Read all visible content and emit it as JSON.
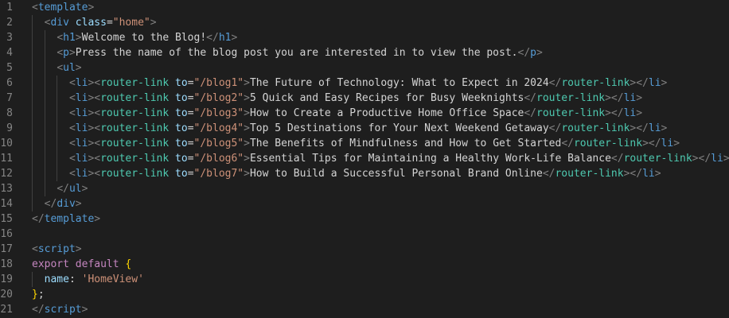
{
  "editor": {
    "language": "vue",
    "colors": {
      "background": "#1e1e1e",
      "tag": "#569cd6",
      "bracket": "#808080",
      "component": "#4ec9b0",
      "attribute": "#9cdcfe",
      "string": "#ce9178",
      "text": "#d4d4d4",
      "keyword": "#c586c0",
      "brace": "#ffd700",
      "line_number": "#858585"
    },
    "lines": [
      {
        "n": "1",
        "indent": 0,
        "tokens": [
          [
            "bracket",
            "<"
          ],
          [
            "tag",
            "template"
          ],
          [
            "bracket",
            ">"
          ]
        ]
      },
      {
        "n": "2",
        "indent": 1,
        "tokens": [
          [
            "bracket",
            "<"
          ],
          [
            "tag",
            "div"
          ],
          [
            "text",
            " "
          ],
          [
            "attr",
            "class"
          ],
          [
            "text",
            "="
          ],
          [
            "str",
            "\"home\""
          ],
          [
            "bracket",
            ">"
          ]
        ]
      },
      {
        "n": "3",
        "indent": 2,
        "tokens": [
          [
            "bracket",
            "<"
          ],
          [
            "tag",
            "h1"
          ],
          [
            "bracket",
            ">"
          ],
          [
            "text",
            "Welcome to the Blog!"
          ],
          [
            "bracket",
            "</"
          ],
          [
            "tag",
            "h1"
          ],
          [
            "bracket",
            ">"
          ]
        ]
      },
      {
        "n": "4",
        "indent": 2,
        "tokens": [
          [
            "bracket",
            "<"
          ],
          [
            "tag",
            "p"
          ],
          [
            "bracket",
            ">"
          ],
          [
            "text",
            "Press the name of the blog post you are interested in to view the post."
          ],
          [
            "bracket",
            "</"
          ],
          [
            "tag",
            "p"
          ],
          [
            "bracket",
            ">"
          ]
        ]
      },
      {
        "n": "5",
        "indent": 2,
        "tokens": [
          [
            "bracket",
            "<"
          ],
          [
            "tag",
            "ul"
          ],
          [
            "bracket",
            ">"
          ]
        ]
      },
      {
        "n": "6",
        "indent": 3,
        "tokens": [
          [
            "bracket",
            "<"
          ],
          [
            "tag",
            "li"
          ],
          [
            "bracket",
            ">"
          ],
          [
            "bracket",
            "<"
          ],
          [
            "comp",
            "router-link"
          ],
          [
            "text",
            " "
          ],
          [
            "attr",
            "to"
          ],
          [
            "text",
            "="
          ],
          [
            "str",
            "\"/blog1\""
          ],
          [
            "bracket",
            ">"
          ],
          [
            "text",
            "The Future of Technology: What to Expect in 2024"
          ],
          [
            "bracket",
            "</"
          ],
          [
            "comp",
            "router-link"
          ],
          [
            "bracket",
            ">"
          ],
          [
            "bracket",
            "</"
          ],
          [
            "tag",
            "li"
          ],
          [
            "bracket",
            ">"
          ]
        ]
      },
      {
        "n": "7",
        "indent": 3,
        "tokens": [
          [
            "bracket",
            "<"
          ],
          [
            "tag",
            "li"
          ],
          [
            "bracket",
            ">"
          ],
          [
            "bracket",
            "<"
          ],
          [
            "comp",
            "router-link"
          ],
          [
            "text",
            " "
          ],
          [
            "attr",
            "to"
          ],
          [
            "text",
            "="
          ],
          [
            "str",
            "\"/blog2\""
          ],
          [
            "bracket",
            ">"
          ],
          [
            "text",
            "5 Quick and Easy Recipes for Busy Weeknights"
          ],
          [
            "bracket",
            "</"
          ],
          [
            "comp",
            "router-link"
          ],
          [
            "bracket",
            ">"
          ],
          [
            "bracket",
            "</"
          ],
          [
            "tag",
            "li"
          ],
          [
            "bracket",
            ">"
          ]
        ]
      },
      {
        "n": "8",
        "indent": 3,
        "tokens": [
          [
            "bracket",
            "<"
          ],
          [
            "tag",
            "li"
          ],
          [
            "bracket",
            ">"
          ],
          [
            "bracket",
            "<"
          ],
          [
            "comp",
            "router-link"
          ],
          [
            "text",
            " "
          ],
          [
            "attr",
            "to"
          ],
          [
            "text",
            "="
          ],
          [
            "str",
            "\"/blog3\""
          ],
          [
            "bracket",
            ">"
          ],
          [
            "text",
            "How to Create a Productive Home Office Space"
          ],
          [
            "bracket",
            "</"
          ],
          [
            "comp",
            "router-link"
          ],
          [
            "bracket",
            ">"
          ],
          [
            "bracket",
            "</"
          ],
          [
            "tag",
            "li"
          ],
          [
            "bracket",
            ">"
          ]
        ]
      },
      {
        "n": "9",
        "indent": 3,
        "tokens": [
          [
            "bracket",
            "<"
          ],
          [
            "tag",
            "li"
          ],
          [
            "bracket",
            ">"
          ],
          [
            "bracket",
            "<"
          ],
          [
            "comp",
            "router-link"
          ],
          [
            "text",
            " "
          ],
          [
            "attr",
            "to"
          ],
          [
            "text",
            "="
          ],
          [
            "str",
            "\"/blog4\""
          ],
          [
            "bracket",
            ">"
          ],
          [
            "text",
            "Top 5 Destinations for Your Next Weekend Getaway"
          ],
          [
            "bracket",
            "</"
          ],
          [
            "comp",
            "router-link"
          ],
          [
            "bracket",
            ">"
          ],
          [
            "bracket",
            "</"
          ],
          [
            "tag",
            "li"
          ],
          [
            "bracket",
            ">"
          ]
        ]
      },
      {
        "n": "10",
        "indent": 3,
        "tokens": [
          [
            "bracket",
            "<"
          ],
          [
            "tag",
            "li"
          ],
          [
            "bracket",
            ">"
          ],
          [
            "bracket",
            "<"
          ],
          [
            "comp",
            "router-link"
          ],
          [
            "text",
            " "
          ],
          [
            "attr",
            "to"
          ],
          [
            "text",
            "="
          ],
          [
            "str",
            "\"/blog5\""
          ],
          [
            "bracket",
            ">"
          ],
          [
            "text",
            "The Benefits of Mindfulness and How to Get Started"
          ],
          [
            "bracket",
            "</"
          ],
          [
            "comp",
            "router-link"
          ],
          [
            "bracket",
            ">"
          ],
          [
            "bracket",
            "</"
          ],
          [
            "tag",
            "li"
          ],
          [
            "bracket",
            ">"
          ]
        ]
      },
      {
        "n": "11",
        "indent": 3,
        "tokens": [
          [
            "bracket",
            "<"
          ],
          [
            "tag",
            "li"
          ],
          [
            "bracket",
            ">"
          ],
          [
            "bracket",
            "<"
          ],
          [
            "comp",
            "router-link"
          ],
          [
            "text",
            " "
          ],
          [
            "attr",
            "to"
          ],
          [
            "text",
            "="
          ],
          [
            "str",
            "\"/blog6\""
          ],
          [
            "bracket",
            ">"
          ],
          [
            "text",
            "Essential Tips for Maintaining a Healthy Work-Life Balance"
          ],
          [
            "bracket",
            "</"
          ],
          [
            "comp",
            "router-link"
          ],
          [
            "bracket",
            ">"
          ],
          [
            "bracket",
            "</"
          ],
          [
            "tag",
            "li"
          ],
          [
            "bracket",
            ">"
          ]
        ]
      },
      {
        "n": "12",
        "indent": 3,
        "tokens": [
          [
            "bracket",
            "<"
          ],
          [
            "tag",
            "li"
          ],
          [
            "bracket",
            ">"
          ],
          [
            "bracket",
            "<"
          ],
          [
            "comp",
            "router-link"
          ],
          [
            "text",
            " "
          ],
          [
            "attr",
            "to"
          ],
          [
            "text",
            "="
          ],
          [
            "str",
            "\"/blog7\""
          ],
          [
            "bracket",
            ">"
          ],
          [
            "text",
            "How to Build a Successful Personal Brand Online"
          ],
          [
            "bracket",
            "</"
          ],
          [
            "comp",
            "router-link"
          ],
          [
            "bracket",
            ">"
          ],
          [
            "bracket",
            "</"
          ],
          [
            "tag",
            "li"
          ],
          [
            "bracket",
            ">"
          ]
        ]
      },
      {
        "n": "13",
        "indent": 2,
        "tokens": [
          [
            "bracket",
            "</"
          ],
          [
            "tag",
            "ul"
          ],
          [
            "bracket",
            ">"
          ]
        ]
      },
      {
        "n": "14",
        "indent": 1,
        "tokens": [
          [
            "bracket",
            "</"
          ],
          [
            "tag",
            "div"
          ],
          [
            "bracket",
            ">"
          ]
        ]
      },
      {
        "n": "15",
        "indent": 0,
        "tokens": [
          [
            "bracket",
            "</"
          ],
          [
            "tag",
            "template"
          ],
          [
            "bracket",
            ">"
          ]
        ]
      },
      {
        "n": "16",
        "indent": 0,
        "tokens": []
      },
      {
        "n": "17",
        "indent": 0,
        "tokens": [
          [
            "bracket",
            "<"
          ],
          [
            "tag",
            "script"
          ],
          [
            "bracket",
            ">"
          ]
        ]
      },
      {
        "n": "18",
        "indent": 0,
        "tokens": [
          [
            "kw",
            "export"
          ],
          [
            "text",
            " "
          ],
          [
            "kw",
            "default"
          ],
          [
            "text",
            " "
          ],
          [
            "brace",
            "{"
          ]
        ]
      },
      {
        "n": "19",
        "indent": 1,
        "tokens": [
          [
            "prop",
            "name"
          ],
          [
            "punct",
            ": "
          ],
          [
            "str",
            "'HomeView'"
          ]
        ]
      },
      {
        "n": "20",
        "indent": 0,
        "tokens": [
          [
            "brace",
            "}"
          ],
          [
            "punct",
            ";"
          ]
        ]
      },
      {
        "n": "21",
        "indent": 0,
        "tokens": [
          [
            "bracket",
            "</"
          ],
          [
            "tag",
            "script"
          ],
          [
            "bracket",
            ">"
          ]
        ]
      }
    ]
  }
}
